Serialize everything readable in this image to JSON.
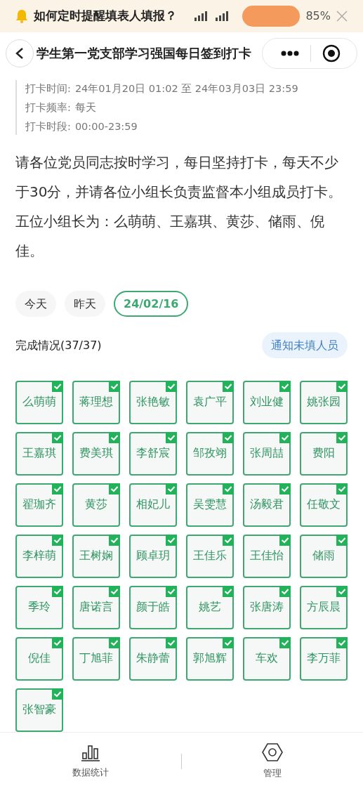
{
  "banner": {
    "title": "如何定时提醒填表人填报？",
    "battery": "85%"
  },
  "title": "学生第一党支部学习强国每日签到打卡",
  "info": [
    {
      "label": "打卡时间:",
      "value": "24年01月20日 01:02 至 24年03月03日 23:59"
    },
    {
      "label": "打卡频率:",
      "value": "每天"
    },
    {
      "label": "打卡时段:",
      "value": "00:00-23:59"
    }
  ],
  "description": "请各位党员同志按时学习，每日坚持打卡，每天不少于30分，并请各位小组长负责监督本小组成员打卡。五位小组长为：么萌萌、王嘉琪、黄莎、储雨、倪佳。",
  "dates": [
    {
      "label": "今天",
      "selected": false
    },
    {
      "label": "昨天",
      "selected": false
    },
    {
      "label": "24/02/16",
      "selected": true
    }
  ],
  "completion": "完成情况(37/37)",
  "notify_button": "通知未填人员",
  "members": [
    {
      "name": "么萌萌",
      "checked": true
    },
    {
      "name": "蒋理想",
      "checked": true
    },
    {
      "name": "张艳敏",
      "checked": true
    },
    {
      "name": "袁广平",
      "checked": true
    },
    {
      "name": "刘业健",
      "checked": true
    },
    {
      "name": "姚张园",
      "checked": true
    },
    {
      "name": "王嘉琪",
      "checked": true
    },
    {
      "name": "费美琪",
      "checked": true
    },
    {
      "name": "李舒宸",
      "checked": true
    },
    {
      "name": "邹孜翊",
      "checked": true
    },
    {
      "name": "张周喆",
      "checked": true
    },
    {
      "name": "费阳",
      "checked": true
    },
    {
      "name": "翟珈齐",
      "checked": true
    },
    {
      "name": "黄莎",
      "checked": true
    },
    {
      "name": "相妃儿",
      "checked": true
    },
    {
      "name": "吴雯慧",
      "checked": true
    },
    {
      "name": "汤毅君",
      "checked": true
    },
    {
      "name": "任敬文",
      "checked": true
    },
    {
      "name": "李梓萌",
      "checked": true
    },
    {
      "name": "王树娴",
      "checked": true
    },
    {
      "name": "顾卓玥",
      "checked": true
    },
    {
      "name": "王佳乐",
      "checked": true
    },
    {
      "name": "王佳怡",
      "checked": true
    },
    {
      "name": "储雨",
      "checked": true
    },
    {
      "name": "季玲",
      "checked": true
    },
    {
      "name": "唐诺言",
      "checked": true
    },
    {
      "name": "颜于皓",
      "checked": true
    },
    {
      "name": "姚艺",
      "checked": true
    },
    {
      "name": "张唐涛",
      "checked": true
    },
    {
      "name": "方辰晨",
      "checked": true
    },
    {
      "name": "倪佳",
      "checked": true
    },
    {
      "name": "丁旭菲",
      "checked": true
    },
    {
      "name": "朱静蕾",
      "checked": true
    },
    {
      "name": "郭旭辉",
      "checked": true
    },
    {
      "name": "车欢",
      "checked": true
    },
    {
      "name": "李万菲",
      "checked": true
    },
    {
      "name": "张智豪",
      "checked": true
    }
  ],
  "bottom_nav": [
    {
      "kind": "stats",
      "label": "数据统计"
    },
    {
      "kind": "manage",
      "label": "管理"
    }
  ]
}
